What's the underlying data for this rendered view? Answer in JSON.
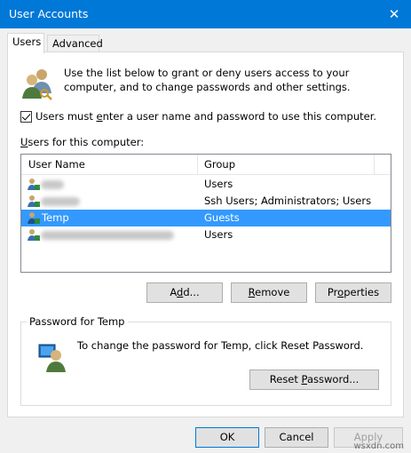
{
  "window": {
    "title": "User Accounts",
    "close_glyph": "✕"
  },
  "tabs": [
    {
      "label": "Users",
      "active": true
    },
    {
      "label": "Advanced",
      "active": false
    }
  ],
  "intro": {
    "text": "Use the list below to grant or deny users access to your computer, and to change passwords and other settings.",
    "icon": "users-icon"
  },
  "checkbox": {
    "label_before": "Users must ",
    "label_accel": "e",
    "label_after": "nter a user name and password to use this computer.",
    "checked": true
  },
  "users_list": {
    "label_accel": "U",
    "label_rest": "sers for this computer:",
    "columns": [
      "User Name",
      "Group"
    ],
    "rows": [
      {
        "name": "",
        "group": "Users",
        "selected": false
      },
      {
        "name": "",
        "group": "Ssh Users; Administrators; Users",
        "selected": false
      },
      {
        "name": "Temp",
        "group": "Guests",
        "selected": true
      },
      {
        "name": "",
        "group": "Users",
        "selected": false
      }
    ]
  },
  "buttons": {
    "add_accel": "d",
    "add_before": "A",
    "add_after": "d...",
    "remove_accel": "R",
    "remove_rest": "emove",
    "props_before": "Pr",
    "props_accel": "o",
    "props_after": "perties"
  },
  "password": {
    "group_title": "Password for Temp",
    "text": "To change the password for Temp, click Reset Password.",
    "reset_before": "Reset ",
    "reset_accel": "P",
    "reset_after": "assword..."
  },
  "footer": {
    "ok": "OK",
    "cancel": "Cancel",
    "apply": "Apply"
  },
  "watermark": "wsxdn.com",
  "colors": {
    "titlebar": "#0078d7",
    "selection": "#3399ff"
  }
}
